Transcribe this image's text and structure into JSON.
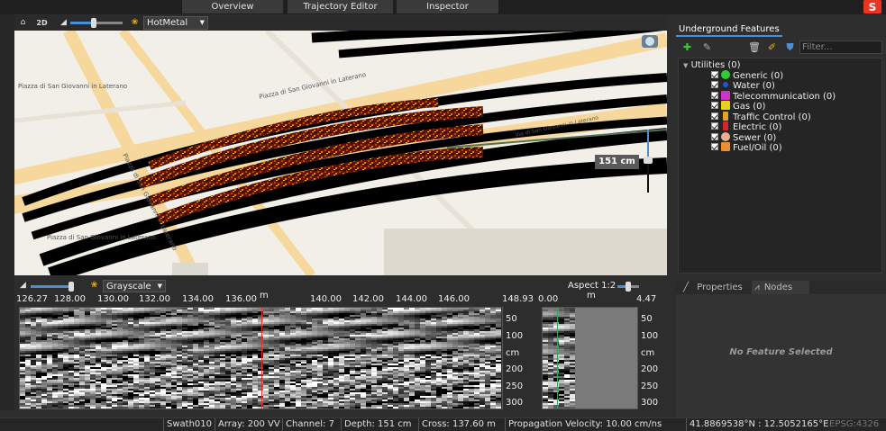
{
  "tabs": [
    {
      "label": "Overview"
    },
    {
      "label": "Trajectory Editor"
    },
    {
      "label": "Inspector"
    }
  ],
  "map_toolbar": {
    "mode_label": "2D",
    "colormap": "HotMetal"
  },
  "map": {
    "street_1": "Piazza di San Giovanni in Laterano",
    "street_2": "Piazza di San Giovanni in Laterano",
    "street_3": "Via di San Giovanni in Laterano",
    "street_4": "Piazza di San Giovanni in Laterano",
    "street_5": "Piazza di San Giovanni in Laterano",
    "depth_label": "151 cm"
  },
  "features_panel": {
    "tab": "Underground Features",
    "filter_placeholder": "Filter...",
    "root": "Utilities (0)",
    "items": [
      {
        "label": "Generic (0)",
        "color": "#33cc33"
      },
      {
        "label": "Water (0)",
        "color": "#2255dd"
      },
      {
        "label": "Telecommunication (0)",
        "color": "#cc33cc"
      },
      {
        "label": "Gas (0)",
        "color": "#e8d020"
      },
      {
        "label": "Traffic Control (0)",
        "color": "#e8a020"
      },
      {
        "label": "Electric (0)",
        "color": "#dd2222"
      },
      {
        "label": "Sewer (0)",
        "color": "#e8b090"
      },
      {
        "label": "Fuel/Oil (0)",
        "color": "#e89030"
      }
    ]
  },
  "properties_panel": {
    "tab_properties": "Properties",
    "tab_nodes": "Nodes",
    "empty_text": "No Feature Selected"
  },
  "radar_toolbar": {
    "colormap": "Grayscale",
    "aspect_label": "Aspect 1:2"
  },
  "ruler_main": {
    "labels": [
      "126.27",
      "128.00",
      "130.00",
      "132.00",
      "134.00",
      "136.00",
      "m",
      "140.00",
      "142.00",
      "144.00",
      "146.00",
      "148.93"
    ]
  },
  "ruler_cross": {
    "left": "0.00",
    "unit": "m",
    "right": "4.47"
  },
  "depth_scale": {
    "labels": [
      "50",
      "100",
      "cm",
      "200",
      "250",
      "300"
    ]
  },
  "status": {
    "swath": "Swath010",
    "array": "Array: 200 VV",
    "channel": "Channel:   7",
    "depth": "Depth:   151 cm",
    "cross": "Cross:    137.60 m",
    "velocity": "Propagation Velocity: 10.00 cm/ns",
    "coords": "41.8869538°N : 12.5052165°E",
    "epsg": "EPSG:4326"
  }
}
